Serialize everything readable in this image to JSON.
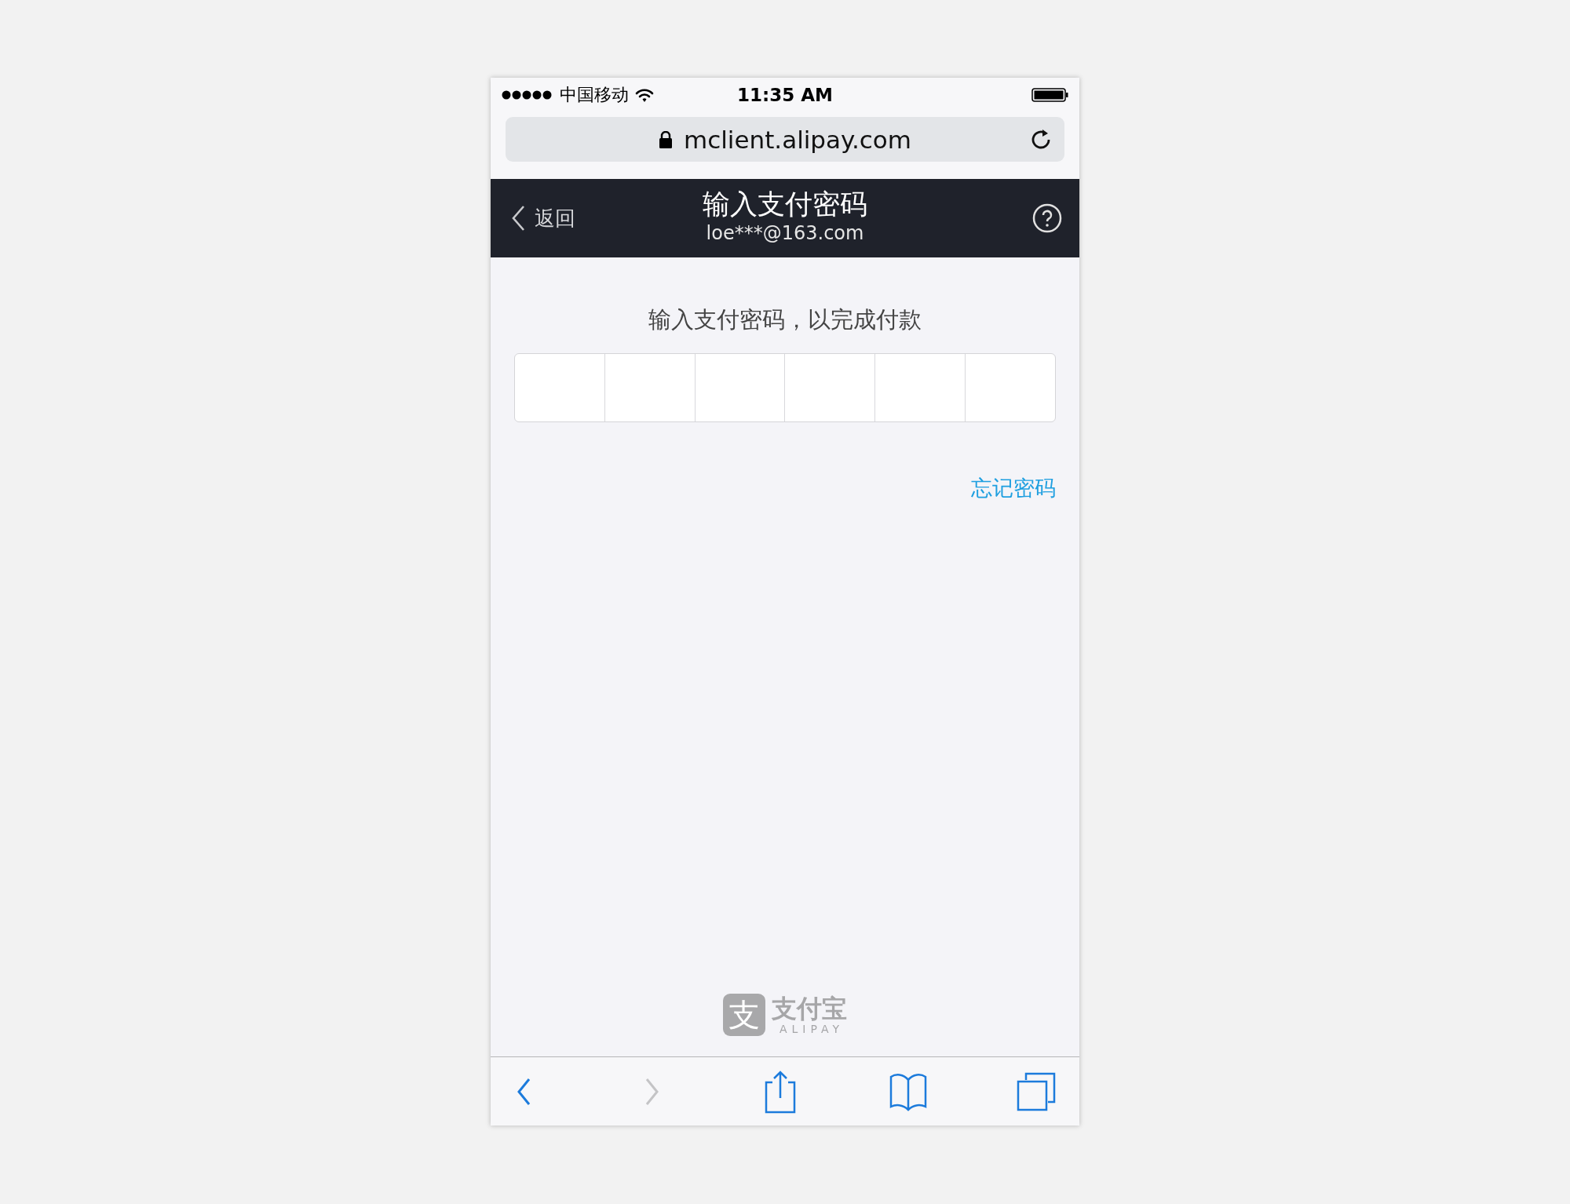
{
  "status_bar": {
    "carrier": "中国移动",
    "time": "11:35 AM"
  },
  "url_bar": {
    "url": "mclient.alipay.com"
  },
  "header": {
    "back_label": "返回",
    "title": "输入支付密码",
    "subtitle": "loe***@163.com"
  },
  "prompt": "输入支付密码，以完成付款",
  "password_field": {
    "cells": [
      {
        "filled": false
      },
      {
        "filled": false
      },
      {
        "filled": false
      },
      {
        "filled": false
      },
      {
        "filled": false
      },
      {
        "filled": false
      }
    ]
  },
  "forgot_link": "忘记密码",
  "logo": {
    "mark": "支",
    "name": "支付宝",
    "latin": "ALIPAY"
  },
  "toolbar": [
    {
      "kind": "back",
      "disabled": false
    },
    {
      "kind": "forward",
      "disabled": true
    },
    {
      "kind": "share",
      "disabled": false
    },
    {
      "kind": "bookmarks",
      "disabled": false
    },
    {
      "kind": "tabs",
      "disabled": false
    }
  ]
}
